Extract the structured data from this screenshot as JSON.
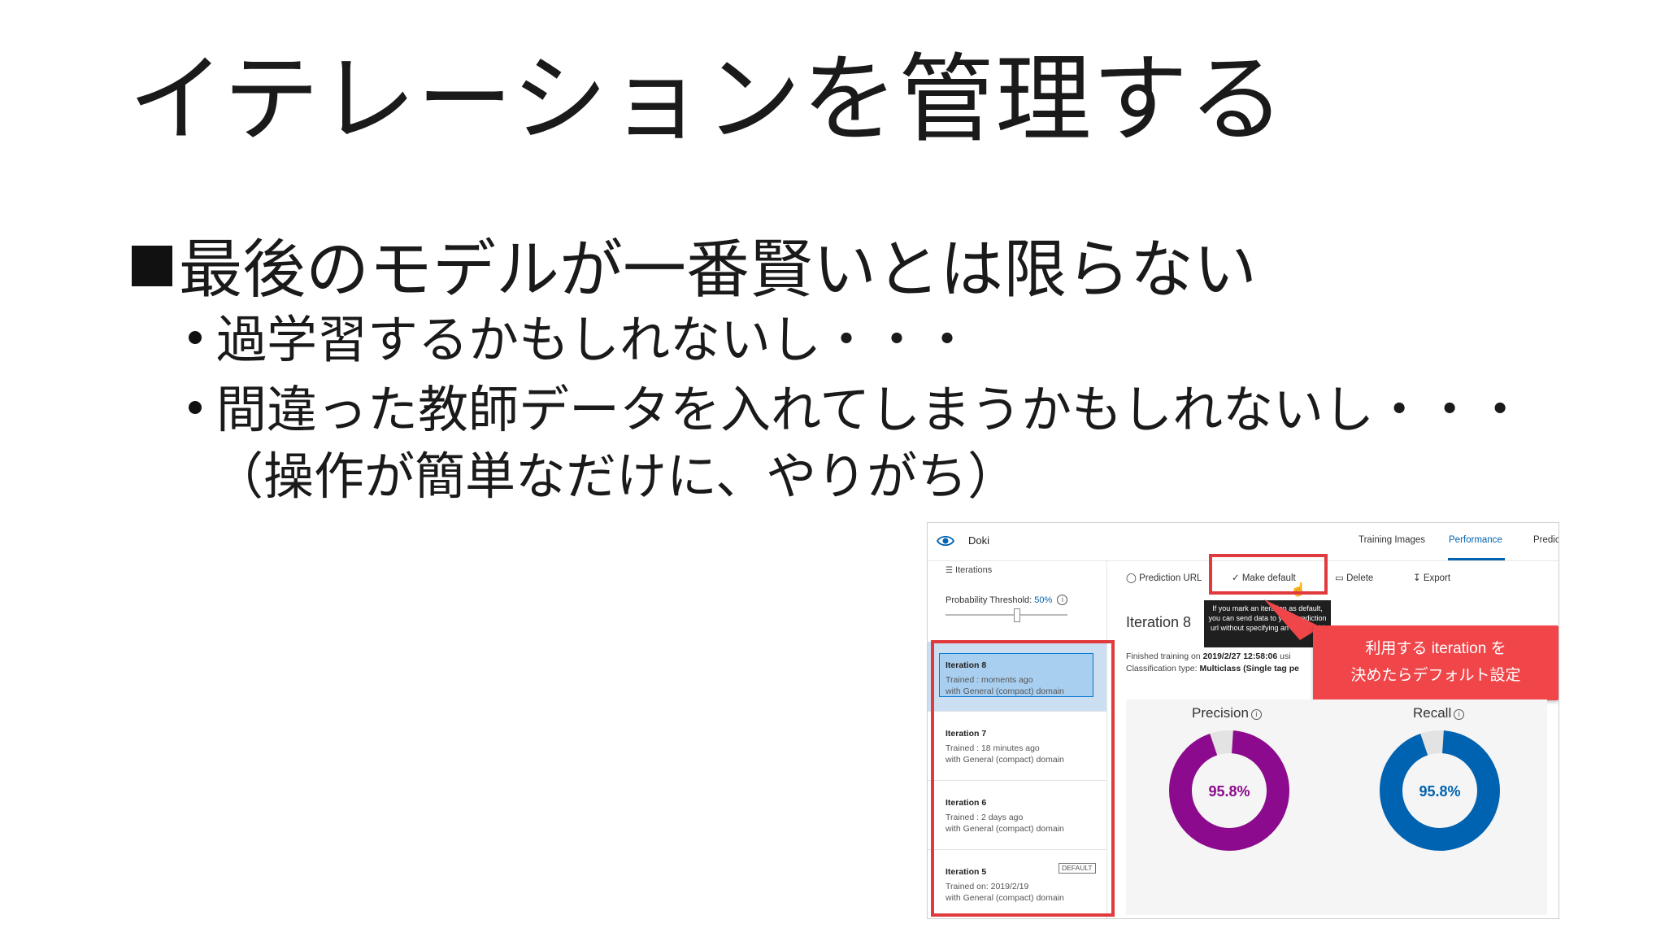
{
  "slide": {
    "title": "イテレーションを管理する",
    "bullet": "最後のモデルが一番賢いとは限らない",
    "subs": [
      "過学習するかもしれないし・・・",
      "間違った教師データを入れてしまうかもしれないし・・・",
      "（操作が簡単なだけに、やりがち）"
    ]
  },
  "app": {
    "name": "Doki",
    "tabs": [
      "Training Images",
      "Performance",
      "Predict"
    ],
    "active_tab": "Performance",
    "sidebar": {
      "header": "Iterations",
      "threshold_label": "Probability Threshold:",
      "threshold_value": "50%",
      "iterations": [
        {
          "name": "Iteration 8",
          "trained": "Trained : moments ago",
          "domain": "with General (compact) domain"
        },
        {
          "name": "Iteration 7",
          "trained": "Trained : 18 minutes ago",
          "domain": "with General (compact) domain"
        },
        {
          "name": "Iteration 6",
          "trained": "Trained : 2 days ago",
          "domain": "with General (compact) domain"
        },
        {
          "name": "Iteration 5",
          "trained": "Trained on: 2019/2/19",
          "domain": "with General (compact) domain",
          "badge": "DEFAULT"
        }
      ]
    },
    "toolbar": {
      "prediction_url": "Prediction URL",
      "make_default": "Make default",
      "delete": "Delete",
      "export": "Export"
    },
    "tooltip": "If you mark an iteration as default, you can send data to your prediction url without specifying an iteration id",
    "callout": [
      "利用する iteration を",
      "決めたらデフォルト設定"
    ],
    "detail": {
      "title": "Iteration 8",
      "finished_prefix": "Finished training on ",
      "finished_value": "2019/2/27 12:58:06",
      "finished_suffix": " usi",
      "class_prefix": "Classification type: ",
      "class_value": "Multiclass (Single tag pe"
    },
    "metrics": {
      "precision_label": "Precision",
      "precision_value": "95.8%",
      "precision_fraction": 0.958,
      "recall_label": "Recall",
      "recall_value": "95.8%",
      "recall_fraction": 0.958,
      "info_glyph": "i"
    },
    "colors": {
      "precision": "#8b0a8d",
      "recall": "#0063b1",
      "highlight": "#e03a3e",
      "accent": "#0063b1"
    }
  }
}
